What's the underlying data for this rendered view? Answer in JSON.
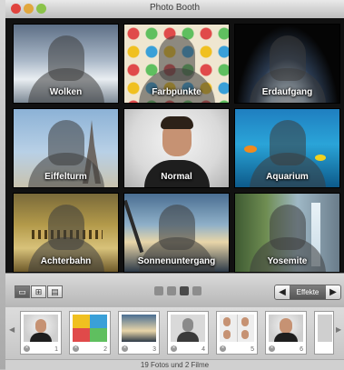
{
  "window": {
    "title": "Photo Booth"
  },
  "effects": [
    {
      "label": "Wolken"
    },
    {
      "label": "Farbpunkte"
    },
    {
      "label": "Erdaufgang"
    },
    {
      "label": "Eiffelturm"
    },
    {
      "label": "Normal"
    },
    {
      "label": "Aquarium"
    },
    {
      "label": "Achterbahn"
    },
    {
      "label": "Sonnenuntergang"
    },
    {
      "label": "Yosemite"
    }
  ],
  "toolbar": {
    "view_buttons": [
      "single-view-icon",
      "grid-view-icon",
      "film-view-icon"
    ],
    "effects_label": "Effekte",
    "page_count": 4,
    "current_page": 3
  },
  "filmstrip": {
    "items": [
      "1",
      "2",
      "3",
      "4",
      "5",
      "6"
    ],
    "status": "19 Fotos und 2 Filme"
  },
  "colors": {
    "accent": "#4a4a4a",
    "toolbar": "#d9d9d9"
  }
}
